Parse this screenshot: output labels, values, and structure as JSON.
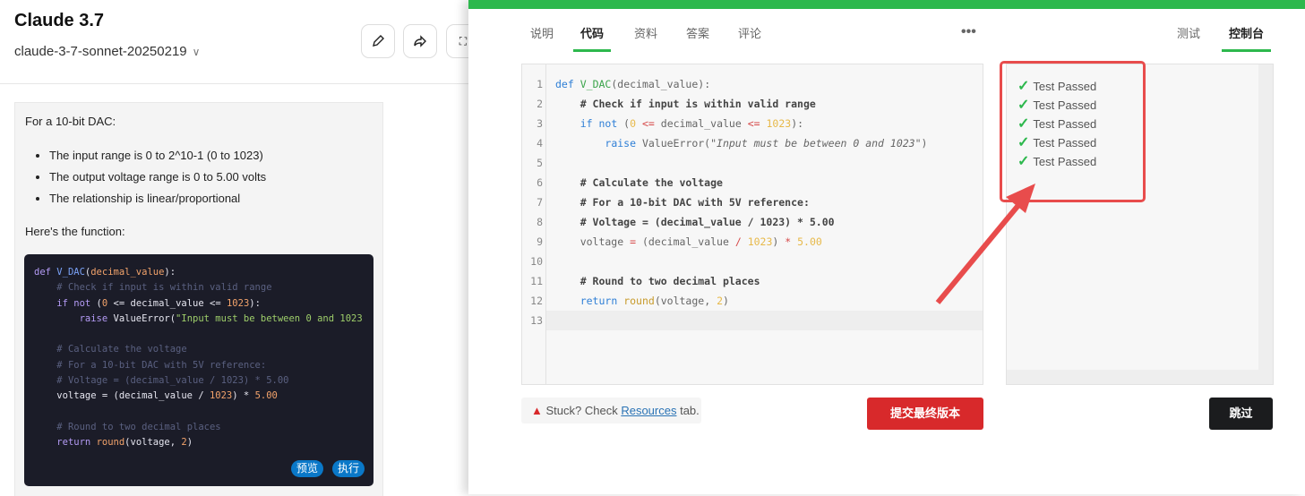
{
  "header": {
    "title": "Claude 3.7",
    "model": "claude-3-7-sonnet-20250219"
  },
  "message": {
    "intro": "For a 10-bit DAC:",
    "bullets": [
      "The input range is 0 to 2^10-1 (0 to 1023)",
      "The output voltage range is 0 to 5.00 volts",
      "The relationship is linear/proportional"
    ],
    "lead": "Here's the function:",
    "code_lines": [
      "def V_DAC(decimal_value):",
      "    # Check if input is within valid range",
      "    if not (0 <= decimal_value <= 1023):",
      "        raise ValueError(\"Input must be between 0 and 1023",
      "",
      "    # Calculate the voltage",
      "    # For a 10-bit DAC with 5V reference:",
      "    # Voltage = (decimal_value / 1023) * 5.00",
      "    voltage = (decimal_value / 1023) * 5.00",
      "",
      "    # Round to two decimal places",
      "    return round(voltage, 2)"
    ],
    "preview_label": "预览",
    "run_label": "执行"
  },
  "tabs": [
    {
      "label": "说明"
    },
    {
      "label": "代码",
      "active": true
    },
    {
      "label": "资料"
    },
    {
      "label": "答案"
    },
    {
      "label": "评论"
    }
  ],
  "right_tabs": [
    {
      "label": "测试"
    },
    {
      "label": "控制台",
      "active": true
    }
  ],
  "editor": {
    "line_numbers": [
      "1",
      "2",
      "3",
      "4",
      "5",
      "6",
      "7",
      "8",
      "9",
      "10",
      "11",
      "12",
      "13"
    ],
    "lines": [
      "def V_DAC(decimal_value):",
      "    # Check if input is within valid range",
      "    if not (0 <= decimal_value <= 1023):",
      "        raise ValueError(\"Input must be between 0 and 1023\")",
      "",
      "    # Calculate the voltage",
      "    # For a 10-bit DAC with 5V reference:",
      "    # Voltage = (decimal_value / 1023) * 5.00",
      "    voltage = (decimal_value / 1023) * 5.00",
      "",
      "    # Round to two decimal places",
      "    return round(voltage, 2)",
      ""
    ]
  },
  "console": {
    "results": [
      "Test Passed",
      "Test Passed",
      "Test Passed",
      "Test Passed",
      "Test Passed"
    ]
  },
  "footer": {
    "stuck_prefix": "Stuck? Check ",
    "stuck_link": "Resources",
    "stuck_suffix": " tab.",
    "submit_label": "提交最终版本",
    "skip_label": "跳过"
  },
  "colors": {
    "accent": "#2db84d",
    "submit": "#d8292b",
    "annotation": "#e84c4c"
  }
}
